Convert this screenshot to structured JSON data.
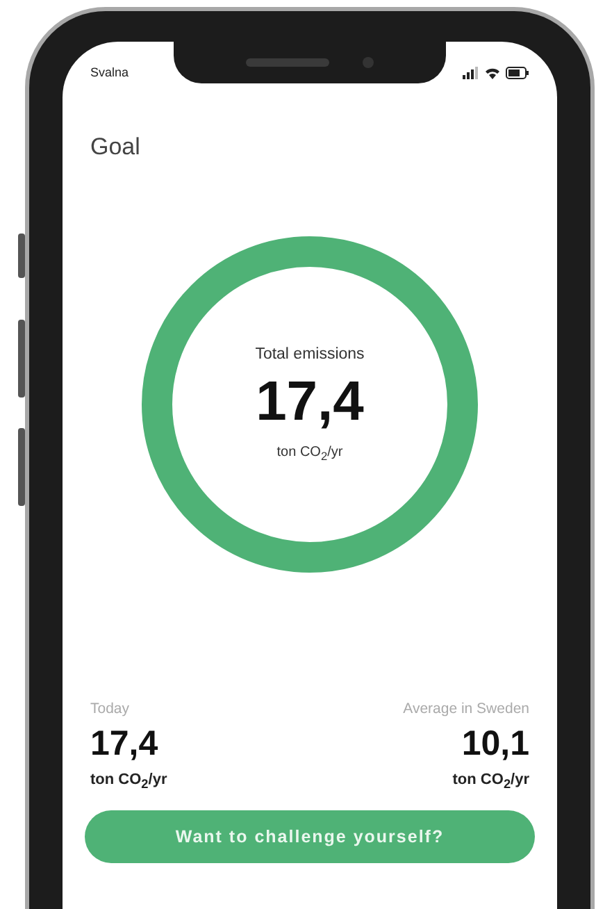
{
  "status_bar": {
    "carrier": "Svalna"
  },
  "header": {
    "title": "Goal"
  },
  "emissions_ring": {
    "label": "Total emissions",
    "value": "17,4",
    "unit": "ton CO$_{2}$/yr"
  },
  "stats": [
    {
      "label": "Today",
      "value": "17,4",
      "unit": "ton CO$_{2}$/yr"
    },
    {
      "label": "Average in Sweden",
      "value": "10,1",
      "unit": "ton CO$_{2}$/yr"
    }
  ],
  "button": {
    "label": "Want to challenge yourself?"
  }
}
